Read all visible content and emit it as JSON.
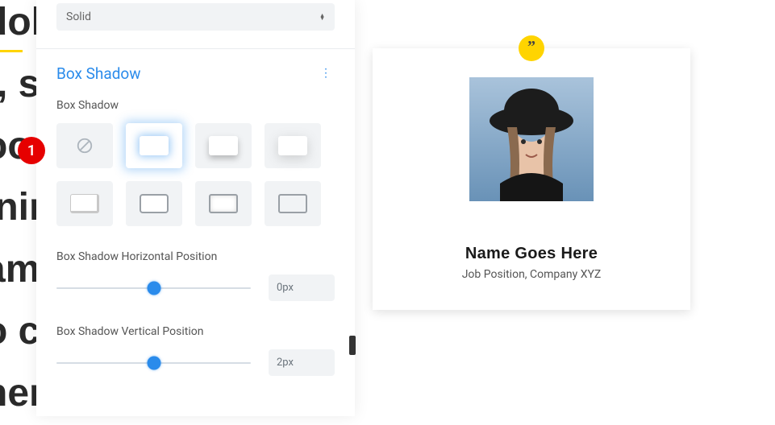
{
  "bg_text": "dol\nt, s\noo\ninin\nam\no co\nher\n",
  "top_select": {
    "value": "Solid"
  },
  "section": {
    "title": "Box Shadow",
    "label": "Box Shadow",
    "presets": [
      {
        "id": "none",
        "name": "box-shadow-none"
      },
      {
        "id": "active",
        "name": "box-shadow-outer-glow"
      },
      {
        "id": "outer",
        "name": "box-shadow-outer"
      },
      {
        "id": "outer-soft",
        "name": "box-shadow-outer-soft"
      },
      {
        "id": "inner-b",
        "name": "box-shadow-inner-bottom"
      },
      {
        "id": "outline",
        "name": "box-shadow-outline"
      },
      {
        "id": "spread",
        "name": "box-shadow-inner-spread"
      },
      {
        "id": "hollow",
        "name": "box-shadow-hollow"
      }
    ]
  },
  "sliders": {
    "horizontal": {
      "label": "Box Shadow Horizontal Position",
      "value": "0px",
      "thumb_pct": 50
    },
    "vertical": {
      "label": "Box Shadow Vertical Position",
      "value": "2px",
      "thumb_pct": 50
    }
  },
  "badge": {
    "num": "1"
  },
  "preview": {
    "name": "Name Goes Here",
    "job": "Job Position, Company XYZ",
    "quote_glyph": "”"
  }
}
